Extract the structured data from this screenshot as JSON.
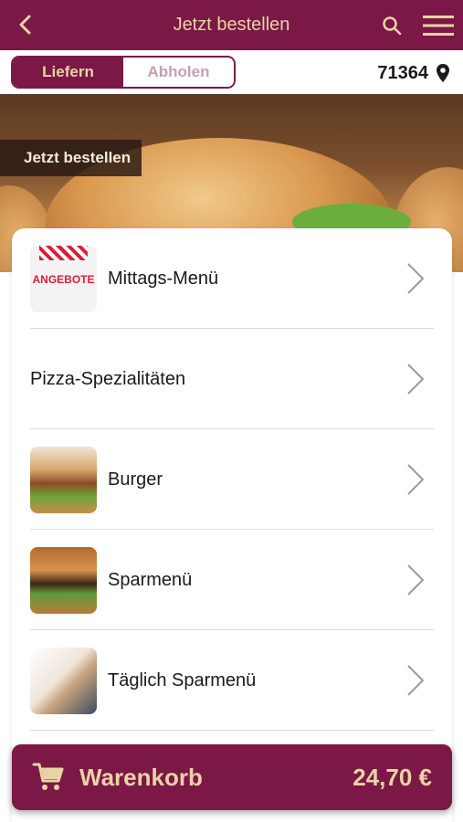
{
  "header": {
    "title": "Jetzt bestellen",
    "back_icon": "chevron-left-icon",
    "search_icon": "search-icon",
    "menu_icon": "hamburger-menu-icon"
  },
  "delivery_toggle": {
    "options": [
      "Liefern",
      "Abholen"
    ],
    "selected": "Liefern"
  },
  "location": {
    "zip": "71364",
    "icon": "location-pin-icon"
  },
  "hero": {
    "label": "Jetzt bestellen"
  },
  "categories": [
    {
      "label": "Mittags-Menü",
      "thumb_text": "ANGEBOTE"
    },
    {
      "label": "Pizza-Spezialitäten"
    },
    {
      "label": "Burger"
    },
    {
      "label": "Sparmenü"
    },
    {
      "label": "Täglich Sparmenü"
    }
  ],
  "cart": {
    "label": "Warenkorb",
    "total": "24,70 €",
    "icon": "shopping-cart-icon"
  },
  "colors": {
    "brand": "#7b1845",
    "accent_text": "#e9d3a6"
  }
}
